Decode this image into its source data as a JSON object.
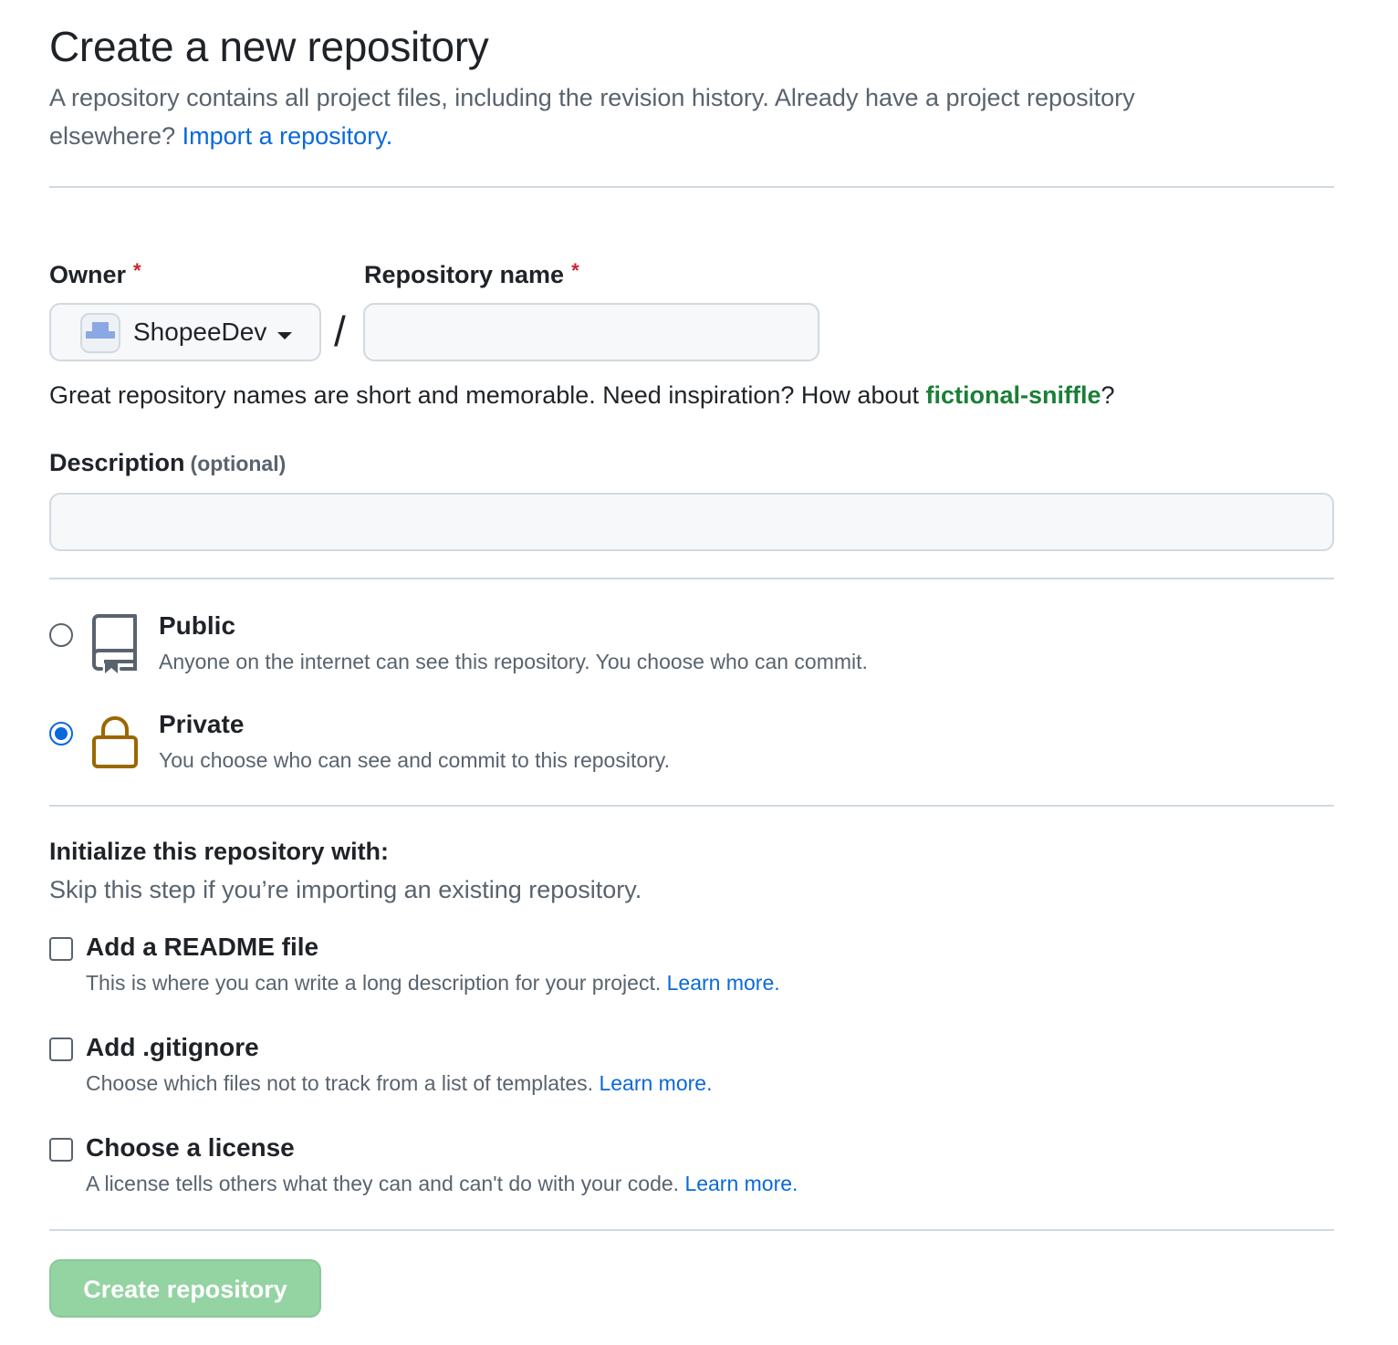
{
  "header": {
    "title": "Create a new repository",
    "subtitle": "A repository contains all project files, including the revision history. Already have a project repository elsewhere?",
    "import_link": "Import a repository."
  },
  "form": {
    "owner": {
      "label": "Owner",
      "required_mark": "*",
      "selected": "ShopeeDev"
    },
    "separator": "/",
    "repo_name": {
      "label": "Repository name",
      "required_mark": "*",
      "value": "",
      "placeholder": ""
    },
    "name_hint": {
      "text": "Great repository names are short and memorable. Need inspiration? How about ",
      "suggestion": "fictional-sniffle",
      "suffix": "?"
    },
    "description": {
      "label": "Description",
      "optional": "(optional)",
      "value": "",
      "placeholder": ""
    }
  },
  "visibility": {
    "selected": "private",
    "options": [
      {
        "title": "Public",
        "desc": "Anyone on the internet can see this repository. You choose who can commit.",
        "icon": "repo-icon"
      },
      {
        "title": "Private",
        "desc": "You choose who can see and commit to this repository.",
        "icon": "lock-icon"
      }
    ]
  },
  "initialize": {
    "title": "Initialize this repository with:",
    "subtitle": "Skip this step if you’re importing an existing repository.",
    "options": [
      {
        "title": "Add a README file",
        "desc": "This is where you can write a long description for your project.",
        "link": "Learn more.",
        "checked": false
      },
      {
        "title": "Add .gitignore",
        "desc": "Choose which files not to track from a list of templates.",
        "link": "Learn more.",
        "checked": false
      },
      {
        "title": "Choose a license",
        "desc": "A license tells others what they can and can't do with your code.",
        "link": "Learn more.",
        "checked": false
      }
    ]
  },
  "actions": {
    "create_label": "Create repository"
  },
  "colors": {
    "accent": "#0969da",
    "success_text": "#1a7f37",
    "required": "#cf222e",
    "disabled_button": "#94d3a2",
    "lock_icon": "#9a6700"
  }
}
